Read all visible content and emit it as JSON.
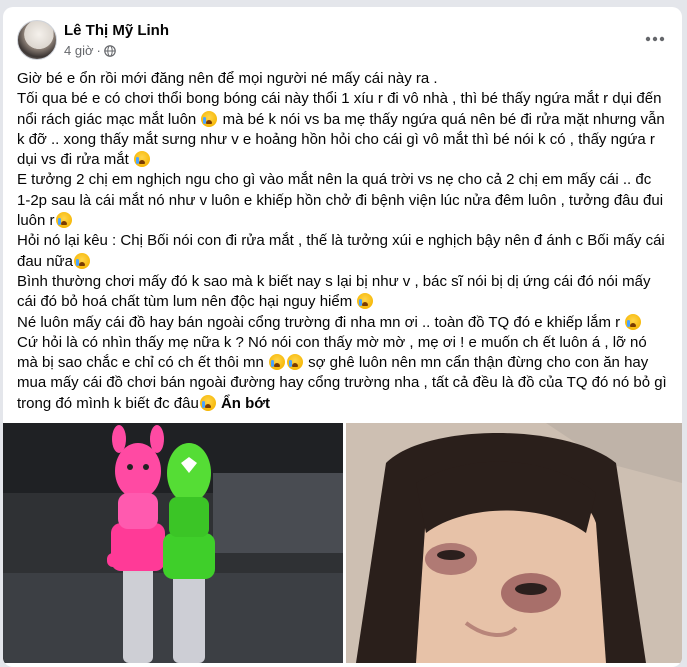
{
  "post": {
    "author": "Lê Thị Mỹ Linh",
    "time": "4 giờ",
    "dot": "·",
    "more_icon": "more-dots-icon",
    "privacy_icon": "globe-icon",
    "see_less_label": "Ẩn bớt",
    "paragraphs": [
      "Giờ bé e ổn rồi mới đăng nên để mọi người né mấy cái này ra .",
      "Tối qua bé e có chơi thổi bong bóng cái này thổi 1 xíu r đi vô nhà , thì bé thấy ngứa mắt r dụi đến nổi rách giác mạc mắt luôn",
      " mà bé k nói vs ba mẹ thấy ngứa quá nên bé đi rửa mặt nhưng vẫn k đỡ .. xong thấy mắt sưng như v e hoảng hồn hỏi cho cái gì vô mắt thì bé nói k có , thấy ngứa r dụi vs đi rửa mắt",
      "E tưởng 2 chị em nghịch ngu cho gì vào mắt nên la quá trời vs nẹ cho cả 2 chị em mấy cái .. đc 1-2p sau là cái mắt nó như v luôn e khiếp hồn chở đi bệnh viện lúc nửa đêm luôn , tưởng đâu đui luôn r",
      "Hỏi nó lại kêu : Chị Bối nói con đi rửa mắt , thế là tưởng xúi e nghịch bậy nên đ ánh c Bối mấy cái đau nữa",
      "Bình thường chơi mấy đó k sao mà k biết nay s lại bị như v , bác sĩ nói bị dị ứng cái đó nói mấy cái đó bỏ hoá chất tùm lum nên độc hại nguy hiểm",
      "Né luôn mấy cái đồ hay bán ngoài cổng trường đi nha mn ơi .. toàn đồ TQ đó e khiếp lắm r",
      "Cứ hỏi là có nhìn thấy mẹ nữa k ? Nó nói con thấy mờ mờ , mẹ ơi ! e muốn ch ết luôn á , lỡ nó mà bị sao chắc e chỉ có ch ết thôi mn",
      " sợ ghê luôn nên mn cẩn thận đừng cho con ăn hay mua mấy cái đồ chơi bán ngoài đường hay cổng trường nha , tất cả đều là đồ của TQ đó nó bỏ gì trong đó mình k biết đc đâu"
    ]
  },
  "media": {
    "left_photo_icon": "bubble-wand-toys-photo",
    "right_photo_icon": "child-swollen-eyes-photo"
  }
}
